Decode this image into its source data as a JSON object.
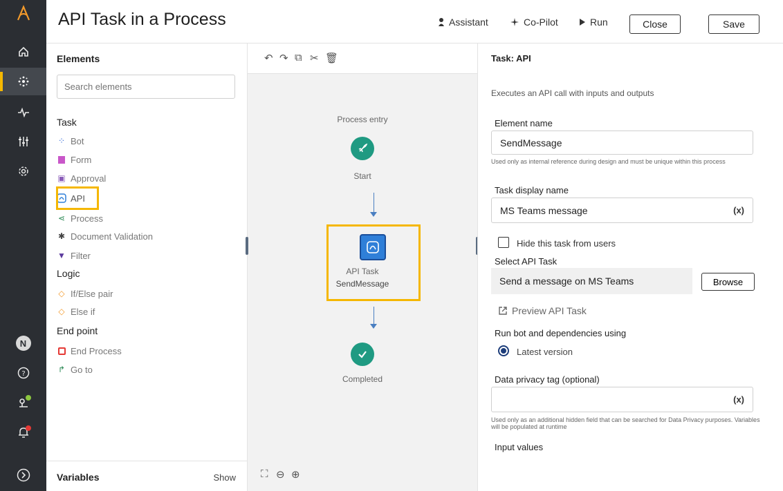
{
  "header": {
    "title": "API Task in a Process",
    "assistant_label": "Assistant",
    "copilot_label": "Co-Pilot",
    "run_label": "Run",
    "close_label": "Close",
    "save_label": "Save"
  },
  "rail": {
    "avatar_initial": "N",
    "icons": [
      "logo-icon",
      "home-icon",
      "automation-icon",
      "activity-icon",
      "manage-icon",
      "settings-icon",
      "help-icon",
      "location-icon",
      "notifications-icon",
      "expand-icon"
    ]
  },
  "elements": {
    "heading": "Elements",
    "search_placeholder": "Search elements",
    "categories": {
      "task": "Task",
      "logic": "Logic",
      "end_point": "End point"
    },
    "task_items": [
      "Bot",
      "Form",
      "Approval",
      "API",
      "Process",
      "Document Validation",
      "Filter"
    ],
    "logic_items": [
      "If/Else pair",
      "Else if"
    ],
    "end_items": [
      "End Process",
      "Go to"
    ],
    "variables_label": "Variables",
    "variables_action": "Show"
  },
  "canvas": {
    "entry_label": "Process entry",
    "start_label": "Start",
    "api_node_type": "API Task",
    "api_node_name": "SendMessage",
    "completed_label": "Completed"
  },
  "properties": {
    "title": "Task: API",
    "description": "Executes an API call with inputs and outputs",
    "element_name_label": "Element name",
    "element_name_value": "SendMessage",
    "element_name_hint": "Used only as internal reference during design and must be unique within this process",
    "display_name_label": "Task display name",
    "display_name_value": "MS Teams message",
    "variable_button": "(x)",
    "hide_task_label": "Hide this task from users",
    "select_api_label": "Select API Task",
    "selected_api": "Send a message on MS Teams",
    "browse_label": "Browse",
    "preview_label": "Preview API Task",
    "run_using_label": "Run bot and dependencies using",
    "latest_version_label": "Latest version",
    "privacy_label": "Data privacy tag (optional)",
    "privacy_hint": "Used only as an additional hidden field that can be searched for Data Privacy purposes. Variables will be populated at runtime",
    "input_values_label": "Input values"
  },
  "colors": {
    "rail_bg": "#2b2e33",
    "highlight": "#f5b700",
    "node_green": "#1f9a82",
    "api_blue": "#2f7fd8"
  }
}
